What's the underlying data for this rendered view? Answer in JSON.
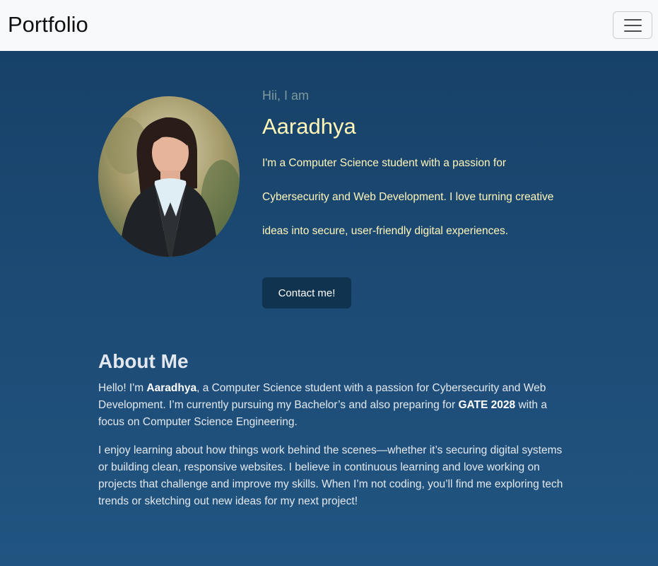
{
  "navbar": {
    "brand": "Portfolio",
    "toggle_icon": "hamburger-menu-icon"
  },
  "hero": {
    "greeting": "Hii, I am",
    "name": "Aaradhya",
    "intro_line1": "I'm a Computer Science student with a passion for",
    "intro_line2": "Cybersecurity and Web Development. I love turning creative",
    "intro_line3": "ideas into secure, user-friendly digital experiences.",
    "contact_label": "Contact me!",
    "photo_icon": "profile-photo"
  },
  "about": {
    "title": "About Me",
    "p1_a": "Hello! I'm ",
    "p1_name": "Aaradhya",
    "p1_b": ", a Computer Science student with a passion for Cybersecurity and Web Development. I’m currently pursuing my Bachelor’s and also preparing for ",
    "p1_exam": "GATE 2028",
    "p1_c": " with a focus on Computer Science Engineering.",
    "p2": "I enjoy learning about how things work behind the scenes—whether it’s securing digital systems or building clean, responsive websites. I believe in continuous learning and love working on projects that challenge and improve my skills. When I’m not coding, you’ll find me exploring tech trends or sketching out new ideas for my next project!"
  },
  "colors": {
    "navbar_bg": "#f8f9fa",
    "page_bg": "#1c4a74",
    "accent_text": "#fff6b8",
    "button_bg": "#10334f"
  }
}
